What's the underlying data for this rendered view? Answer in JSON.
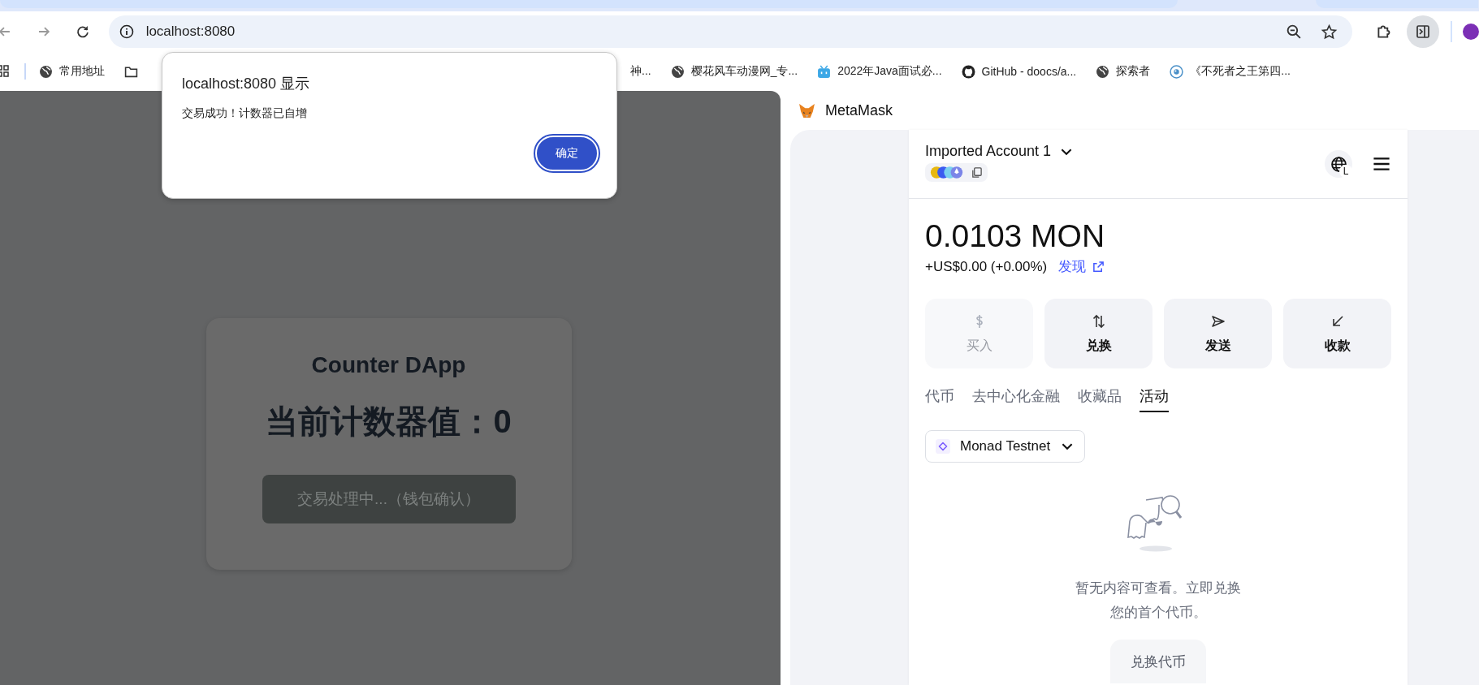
{
  "browser": {
    "address": "localhost:8080",
    "bookmarks": [
      {
        "kind": "globe",
        "label": "常用地址"
      },
      {
        "kind": "folder"
      },
      {
        "kind": "none",
        "label": "神..."
      },
      {
        "kind": "globe",
        "label": "樱花风车动漫网_专..."
      },
      {
        "kind": "tv",
        "label": "2022年Java面试必..."
      },
      {
        "kind": "github",
        "label": "GitHub - doocs/a..."
      },
      {
        "kind": "globe",
        "label": "探索者"
      },
      {
        "kind": "eye",
        "label": "《不死者之王第四..."
      }
    ]
  },
  "dialog": {
    "title": "localhost:8080 显示",
    "message": "交易成功！计数器已自增",
    "ok": "确定"
  },
  "dapp": {
    "title": "Counter DApp",
    "counter": "当前计数器值：0",
    "button": "交易处理中...（钱包确认）",
    "disabled": true
  },
  "metamask": {
    "app": "MetaMask",
    "account": "Imported Account 1",
    "globe_badge": "L",
    "balance": "0.0103 MON",
    "change": "+US$0.00 (+0.00%)",
    "discover": "发现",
    "actions": [
      {
        "kind": "buy",
        "label": "买入",
        "disabled": true
      },
      {
        "kind": "swap",
        "label": "兑换",
        "disabled": false
      },
      {
        "kind": "send",
        "label": "发送",
        "disabled": false
      },
      {
        "kind": "receive",
        "label": "收款",
        "disabled": false
      }
    ],
    "tabs": [
      {
        "label": "代币",
        "selected": false
      },
      {
        "label": "去中心化金融",
        "selected": false
      },
      {
        "label": "收藏品",
        "selected": false
      },
      {
        "label": "活动",
        "selected": true
      }
    ],
    "network": "Monad Testnet",
    "empty": "暂无内容可查看。立即兑换您的首个代币。",
    "swap_button": "兑换代币"
  }
}
